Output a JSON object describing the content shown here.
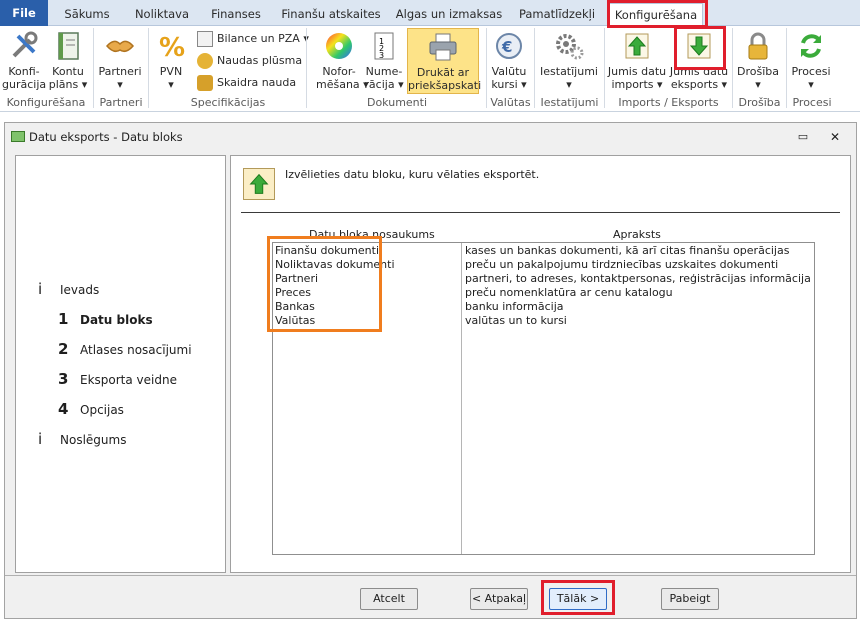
{
  "tabs": {
    "file": "File",
    "items": [
      "Sākums",
      "Noliktava",
      "Finanses",
      "Finanšu atskaites",
      "Algas un izmaksas",
      "Pamatlīdzekļi",
      "Konfigurēšana"
    ]
  },
  "ribbon": {
    "konfiguracija": [
      "Konfi-",
      "gurācija"
    ],
    "kontuplans": [
      "Kontu",
      "plāns ▾"
    ],
    "partneri": [
      "Partneri",
      "▾"
    ],
    "pvn": [
      "PVN",
      "▾"
    ],
    "bilance": "Bilance un PZA ▾",
    "naudas": "Naudas plūsma",
    "skaidra": "Skaidra nauda",
    "noformesana": [
      "Nofor-",
      "mēšana ▾"
    ],
    "numeracija": [
      "Nume-",
      "rācija ▾"
    ],
    "drukat": [
      "Drukāt ar",
      "priekšapskati"
    ],
    "valutu": [
      "Valūtu",
      "kursi ▾"
    ],
    "iestatijumi": [
      "Iestatījumi",
      "▾"
    ],
    "imports": [
      "Jumis datu",
      "imports ▾"
    ],
    "eksports": [
      "Jumis datu",
      "eksports ▾"
    ],
    "drosiba": [
      "Drošība",
      "▾"
    ],
    "procesi": [
      "Procesi",
      "▾"
    ],
    "groups": [
      "Konfigurēšana",
      "Partneri",
      "Specifikācijas",
      "Dokumenti",
      "Valūtas",
      "Iestatījumi",
      "Imports / Eksports",
      "Drošība",
      "Procesi"
    ]
  },
  "dialog": {
    "title": "Datu eksports - Datu bloks",
    "min": "▭",
    "close": "✕",
    "steps": [
      {
        "mark": "i",
        "label": "Ievads"
      },
      {
        "mark": "1",
        "label": "Datu bloks"
      },
      {
        "mark": "2",
        "label": "Atlases nosacījumi"
      },
      {
        "mark": "3",
        "label": "Eksporta veidne"
      },
      {
        "mark": "4",
        "label": "Opcijas"
      },
      {
        "mark": "i",
        "label": "Noslēgums"
      }
    ],
    "prompt": "Izvēlieties datu bloku, kuru vēlaties eksportēt.",
    "col1": "Datu bloka nosaukums",
    "col2": "Apraksts",
    "rows": [
      {
        "name": "Finanšu dokumenti",
        "desc": "kases un bankas dokumenti, kā arī citas finanšu operācijas"
      },
      {
        "name": "Noliktavas dokumenti",
        "desc": "preču un pakalpojumu tirdzniecības uzskaites dokumenti"
      },
      {
        "name": "Partneri",
        "desc": "partneri, to adreses, kontaktpersonas, reģistrācijas informācija"
      },
      {
        "name": "Preces",
        "desc": "preču nomenklatūra ar cenu katalogu"
      },
      {
        "name": "Bankas",
        "desc": "banku informācija"
      },
      {
        "name": "Valūtas",
        "desc": "valūtas un to kursi"
      }
    ],
    "buttons": {
      "cancel": "Atcelt",
      "back": "< Atpakaļ",
      "next": "Tālāk >",
      "finish": "Pabeigt"
    }
  }
}
